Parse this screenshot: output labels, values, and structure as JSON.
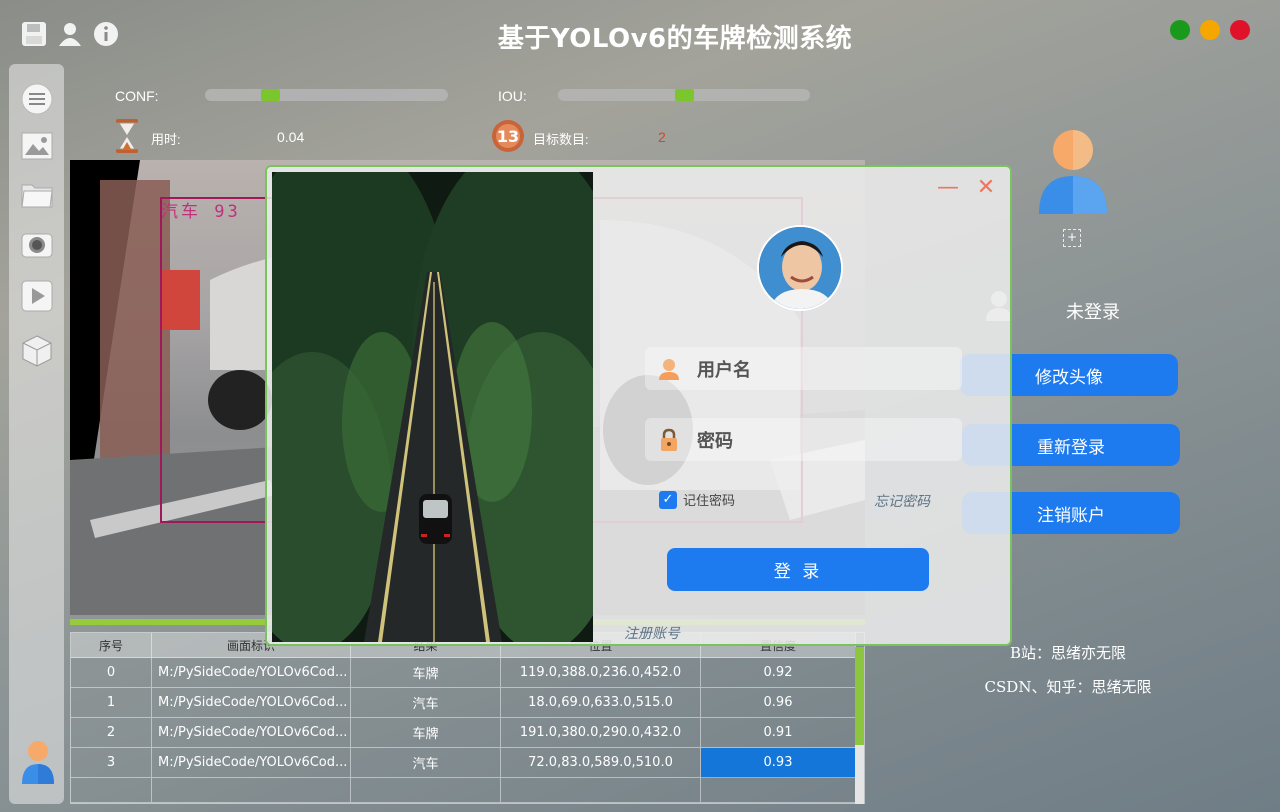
{
  "app": {
    "title": "基于YOLOv6的车牌检测系统",
    "icons": [
      "save-icon",
      "user-icon",
      "info-icon"
    ],
    "window_controls": {
      "maximize_color": "#1a9a1a",
      "minimize_color": "#f5a700",
      "close_color": "#e0122a"
    }
  },
  "sidebar": {
    "items": [
      "menu-icon",
      "image-icon",
      "folder-icon",
      "camera-icon",
      "video-icon",
      "model-icon"
    ]
  },
  "params": {
    "conf_label": "CONF:",
    "conf_value": 0.25,
    "iou_label": "IOU:",
    "iou_value": 0.5,
    "time_label": "用时:",
    "time_value": "0.04",
    "count_label": "目标数目:",
    "count_value": "2"
  },
  "image": {
    "detection_label": "汽车  93"
  },
  "table": {
    "headers": [
      "序号",
      "画面标识",
      "结果",
      "位置",
      "置信度"
    ],
    "rows": [
      [
        "0",
        "M:/PySideCode/YOLOv6Cod...",
        "车牌",
        "119.0,388.0,236.0,452.0",
        "0.92"
      ],
      [
        "1",
        "M:/PySideCode/YOLOv6Cod...",
        "汽车",
        "18.0,69.0,633.0,515.0",
        "0.96"
      ],
      [
        "2",
        "M:/PySideCode/YOLOv6Cod...",
        "车牌",
        "191.0,380.0,290.0,432.0",
        "0.91"
      ],
      [
        "3",
        "M:/PySideCode/YOLOv6Cod...",
        "汽车",
        "72.0,83.0,589.0,510.0",
        "0.93"
      ]
    ],
    "selected_row": 3
  },
  "account": {
    "status": "未登录",
    "avatar_plus": "+",
    "change_avatar": "修改头像",
    "relogin": "重新登录",
    "delete_account": "注销账户"
  },
  "credits": {
    "line1": "B站：思绪亦无限",
    "line2": "CSDN、知乎：思绪无限"
  },
  "login": {
    "minimize": "—",
    "close": "✕",
    "username_placeholder": "用户名",
    "password_placeholder": "密码",
    "remember_label": "记住密码",
    "remember_checked": true,
    "forgot_link": "忘记密码",
    "login_button": "登 录",
    "register_link": "注册账号"
  },
  "colors": {
    "accent": "#1e7bef",
    "slider_knob": "#7bc62d",
    "dialog_border": "#79c35d",
    "count_value": "#e0412a"
  }
}
